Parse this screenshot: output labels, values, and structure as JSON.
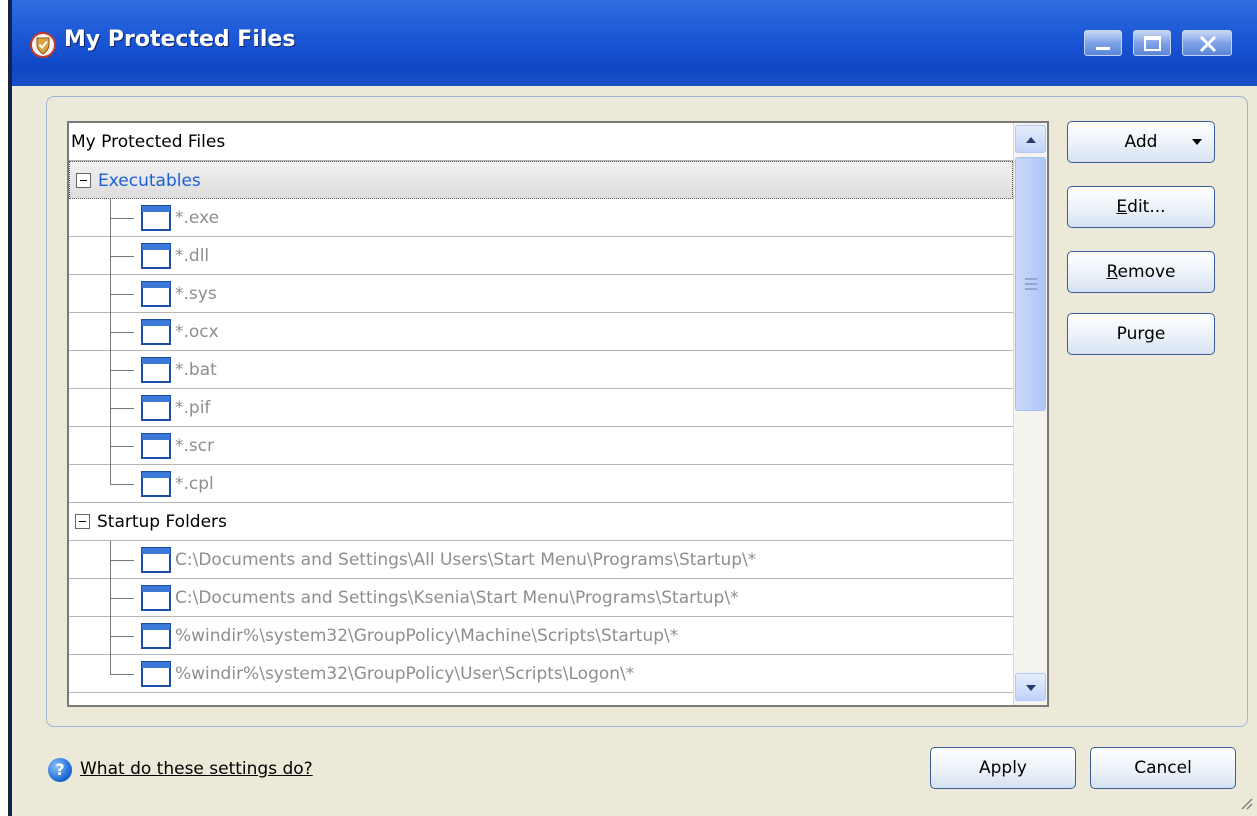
{
  "window": {
    "title": "My Protected Files",
    "icon": "shield-app-icon",
    "controls": [
      "minimize-icon",
      "maximize-icon",
      "close-icon"
    ]
  },
  "tree": {
    "root_label": "My Protected Files",
    "groups": [
      {
        "label": "Executables",
        "expanded": true,
        "selected": true,
        "items": [
          "*.exe",
          "*.dll",
          "*.sys",
          "*.ocx",
          "*.bat",
          "*.pif",
          "*.scr",
          "*.cpl"
        ]
      },
      {
        "label": "Startup Folders",
        "expanded": true,
        "selected": false,
        "items": [
          "C:\\Documents and Settings\\All Users\\Start Menu\\Programs\\Startup\\*",
          "C:\\Documents and Settings\\Ksenia\\Start Menu\\Programs\\Startup\\*",
          "%windir%\\system32\\GroupPolicy\\Machine\\Scripts\\Startup\\*",
          "%windir%\\system32\\GroupPolicy\\User\\Scripts\\Logon\\*"
        ]
      }
    ]
  },
  "side_buttons": {
    "add": "Add",
    "edit_mnemonic": "E",
    "edit_rest": "dit...",
    "remove_mnemonic": "R",
    "remove_rest": "emove",
    "purge": "Purge"
  },
  "footer": {
    "help_link": "What do these settings do?",
    "help_icon_glyph": "?",
    "apply": "Apply",
    "cancel": "Cancel"
  },
  "colors": {
    "titlebar": "#1752d2",
    "group_selected_text": "#1c5fd8",
    "item_text": "#8e8e8e",
    "dialog_bg": "#ece9d8"
  }
}
